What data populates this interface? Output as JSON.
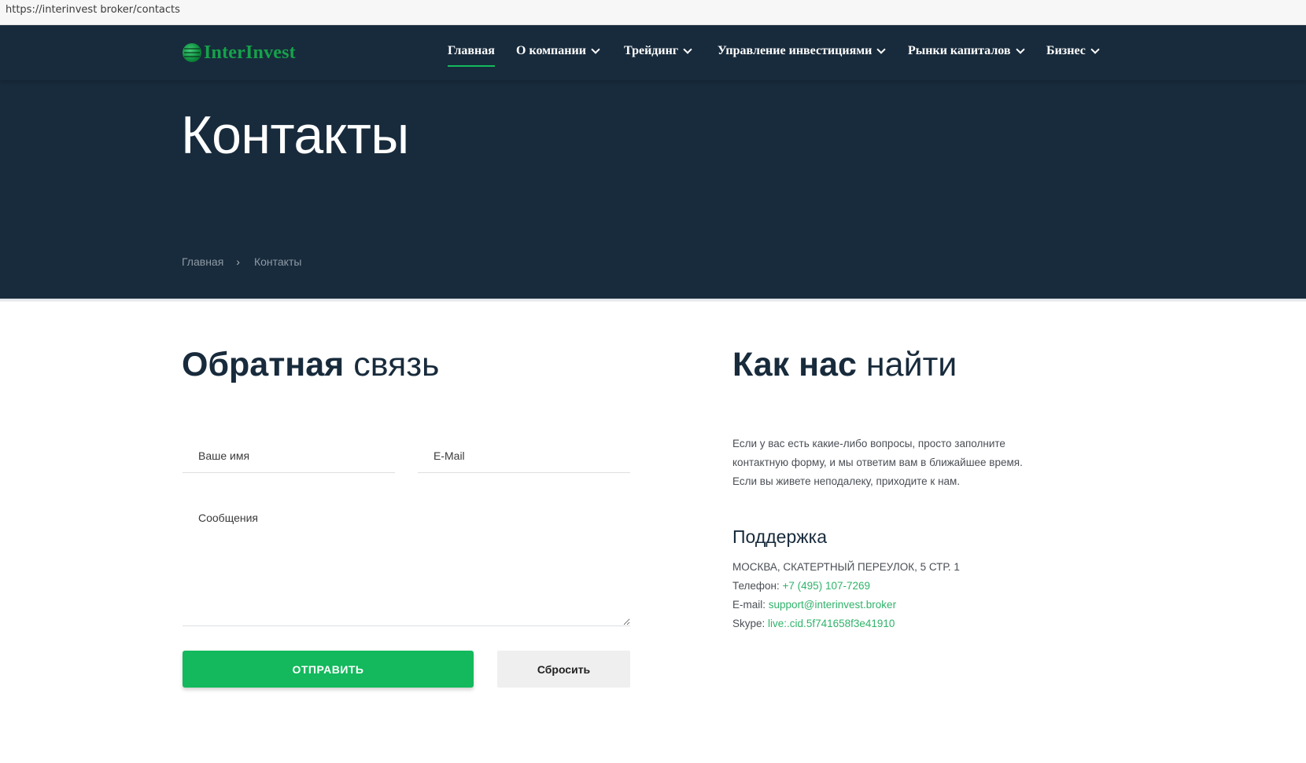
{
  "browser": {
    "url": "https://interinvest broker/contacts"
  },
  "colors": {
    "hero_bg": "#182b3c",
    "accent": "#13b95c",
    "text_dark": "#182b3c"
  },
  "logo": {
    "text": "InterInvest",
    "icon": "globe-icon"
  },
  "nav": {
    "items": [
      {
        "label": "Главная",
        "dropdown": false,
        "active": true
      },
      {
        "label": "О компании",
        "dropdown": true
      },
      {
        "label": "Трейдинг",
        "dropdown": true
      },
      {
        "label": "Управление инвестициями",
        "dropdown": true
      },
      {
        "label": "Рынки капиталов",
        "dropdown": true
      },
      {
        "label": "Бизнес",
        "dropdown": true
      }
    ]
  },
  "hero": {
    "title": "Контакты",
    "breadcrumb": {
      "home": "Главная",
      "separator": "›",
      "current": "Контакты"
    }
  },
  "feedback": {
    "title_bold": "Обратная",
    "title_light": "связь",
    "name_placeholder": "Ваше имя",
    "email_placeholder": "E-Mail",
    "message_placeholder": "Сообщения",
    "submit_label": "ОТПРАВИТЬ",
    "reset_label": "Сбросить"
  },
  "find_us": {
    "title_bold": "Как нас",
    "title_light": "найти",
    "intro": "Если у вас есть какие-либо вопросы, просто заполните контактную форму, и мы ответим вам в ближайшее время. Если вы живете неподалеку, приходите к нам.",
    "support_title": "Поддержка",
    "address": "МОСКВА, СКАТЕРТНЫЙ ПЕРЕУЛОК, 5 СТР. 1",
    "phone_label": "Телефон:",
    "phone": "+7 (495) 107-7269",
    "email_label": "E-mail:",
    "email": "support@interinvest.broker",
    "skype_label": "Skype:",
    "skype": "live:.cid.5f741658f3e41910"
  }
}
